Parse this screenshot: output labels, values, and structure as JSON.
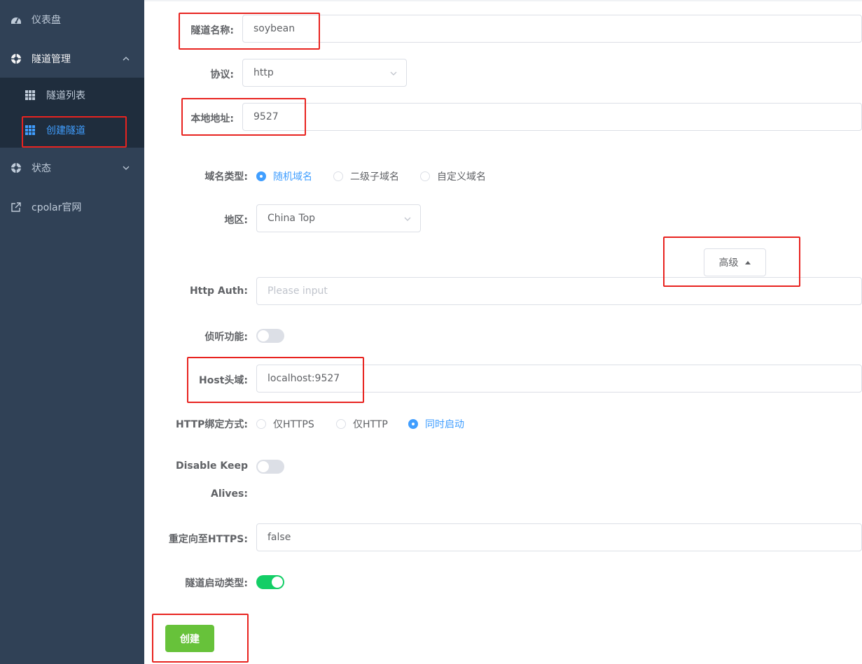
{
  "sidebar": {
    "dashboard": {
      "label": "仪表盘",
      "icon": "dashboard-icon"
    },
    "tunnel_mgmt": {
      "label": "隧道管理",
      "icon": "lifebuoy-icon"
    },
    "tunnel_list": {
      "label": "隧道列表",
      "icon": "table-icon"
    },
    "create_tunnel": {
      "label": "创建隧道",
      "icon": "table-icon"
    },
    "status": {
      "label": "状态",
      "icon": "lifebuoy-icon"
    },
    "cpolar_site": {
      "label": "cpolar官网",
      "icon": "external-link-icon"
    }
  },
  "form": {
    "tunnel_name": {
      "label": "隧道名称:",
      "value": "soybean"
    },
    "protocol": {
      "label": "协议:",
      "value": "http"
    },
    "local_address": {
      "label": "本地地址:",
      "value": "9527"
    },
    "domain_type": {
      "label": "域名类型:",
      "options": [
        "随机域名",
        "二级子域名",
        "自定义域名"
      ],
      "selected": "随机域名"
    },
    "region": {
      "label": "地区:",
      "value": "China Top"
    },
    "advanced_label": "高级",
    "http_auth": {
      "label": "Http Auth:",
      "placeholder": "Please input"
    },
    "listen": {
      "label": "侦听功能:",
      "on": false
    },
    "host_header": {
      "label": "Host头域:",
      "value": "localhost:9527"
    },
    "http_bind": {
      "label": "HTTP绑定方式:",
      "options": [
        "仅HTTPS",
        "仅HTTP",
        "同时启动"
      ],
      "selected": "同时启动"
    },
    "disable_keepalives": {
      "label_line1": "Disable Keep",
      "label_line2": "Alives:",
      "on": false
    },
    "redirect_https": {
      "label": "重定向至HTTPS:",
      "value": "false"
    },
    "start_type": {
      "label": "隧道启动类型:",
      "on": true
    },
    "create_label": "创建"
  },
  "colors": {
    "sidebar_bg": "#304156",
    "submenu_bg": "#1f2d3d",
    "accent": "#409eff",
    "switch_on": "#13ce66",
    "create_btn": "#67c23a",
    "highlight": "#e8231f"
  }
}
